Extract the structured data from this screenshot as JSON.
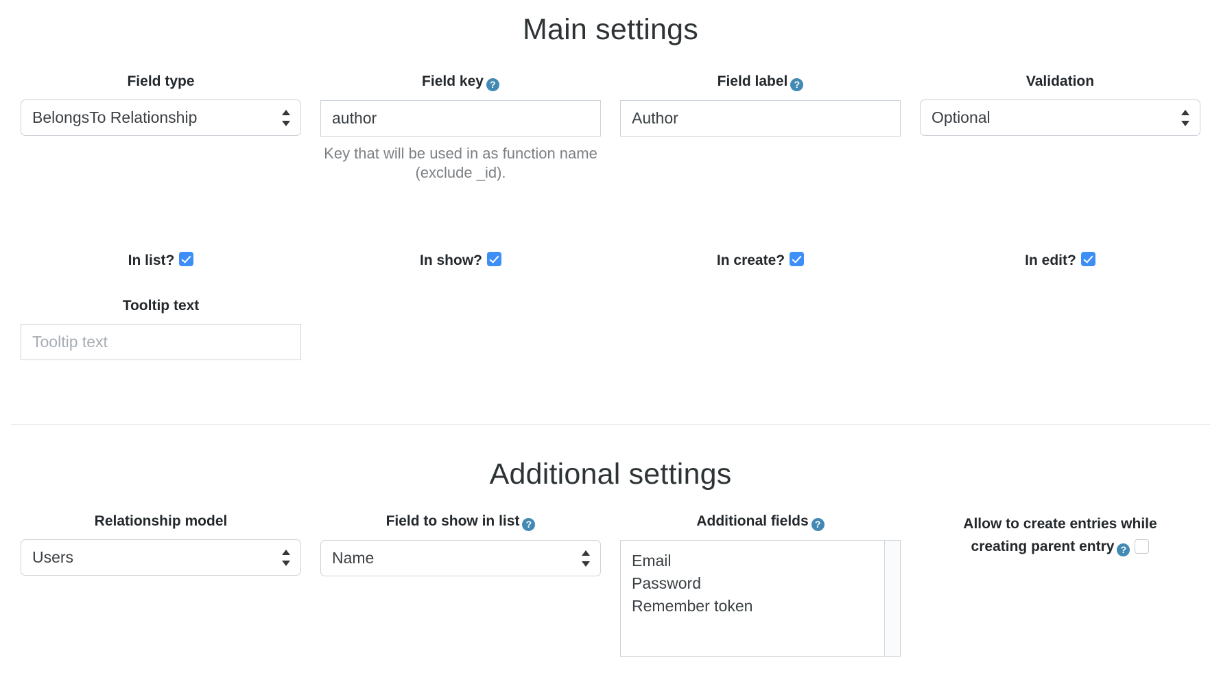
{
  "sections": {
    "main": {
      "title": "Main settings",
      "fields": {
        "field_type": {
          "label": "Field type",
          "value": "BelongsTo Relationship",
          "control": "select"
        },
        "field_key": {
          "label": "Field key",
          "help_icon": "?",
          "value": "author",
          "placeholder": "",
          "help_text": "Key that will be used in as function name (exclude _id).",
          "control": "text"
        },
        "field_label": {
          "label": "Field label",
          "help_icon": "?",
          "value": "Author",
          "placeholder": "",
          "control": "text"
        },
        "validation": {
          "label": "Validation",
          "value": "Optional",
          "control": "select"
        }
      },
      "checkboxes": [
        {
          "label": "In list?",
          "checked": true
        },
        {
          "label": "In show?",
          "checked": true
        },
        {
          "label": "In create?",
          "checked": true
        },
        {
          "label": "In edit?",
          "checked": true
        }
      ],
      "tooltip": {
        "label": "Tooltip text",
        "value": "",
        "placeholder": "Tooltip text",
        "control": "text"
      }
    },
    "additional": {
      "title": "Additional settings",
      "fields": {
        "relationship_model": {
          "label": "Relationship model",
          "value": "Users",
          "control": "select"
        },
        "field_to_show": {
          "label": "Field to show in list",
          "help_icon": "?",
          "value": "Name",
          "control": "select"
        },
        "additional_fields": {
          "label": "Additional fields",
          "help_icon": "?",
          "options": [
            "Email",
            "Password",
            "Remember token"
          ],
          "control": "listbox"
        },
        "allow_create": {
          "label_line1": "Allow to create entries while",
          "label_line2": "creating parent entry",
          "help_icon": "?",
          "checked": false,
          "control": "checkbox"
        }
      }
    }
  },
  "colors": {
    "checkbox_blue": "#3e8ef7",
    "help_icon_blue": "#4289b3",
    "border_grey": "#ccd2d9",
    "text_dark": "#2f3337",
    "muted_text": "#7b8084",
    "divider": "#e6e8ea",
    "background": "#ffffff"
  }
}
